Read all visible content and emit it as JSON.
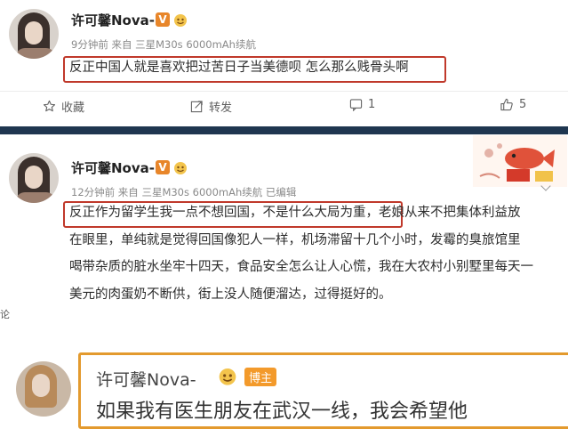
{
  "post1": {
    "username": "许可馨Nova-",
    "meta": "9分钟前 来自 三星M30s 6000mAh续航",
    "text": "反正中国人就是喜欢把过苦日子当美德呗 怎么那么贱骨头啊",
    "actions": {
      "favorite_label": "收藏",
      "repost_label": "转发",
      "comment_count": "1",
      "like_count": "5"
    }
  },
  "post2": {
    "username": "许可馨Nova-",
    "meta": "12分钟前 来自 三星M30s 6000mAh续航 已编辑",
    "lines": [
      "反正作为留学生我一点不想回国，不是什么大局为重，老娘从来不把集体利益放",
      "在眼里，单纯就是觉得回国像犯人一样，机场滞留十几个小时，发霉的臭旅馆里",
      "喝带杂质的脏水坐牢十四天，食品安全怎么让人心慌，我在大农村小别墅里每天一",
      "美元的肉蛋奶不断供，街上没人随便溜达，过得挺好的。"
    ]
  },
  "left_edge_text": "论",
  "post3": {
    "username": "许可馨Nova-",
    "badge_label": "博主",
    "text_partial": "如果我有医生朋友在武汉一线，我会希望他"
  },
  "colors": {
    "highlight_border": "#c0392b",
    "vip_badge": "#e8862a",
    "divider": "#1f3650"
  }
}
